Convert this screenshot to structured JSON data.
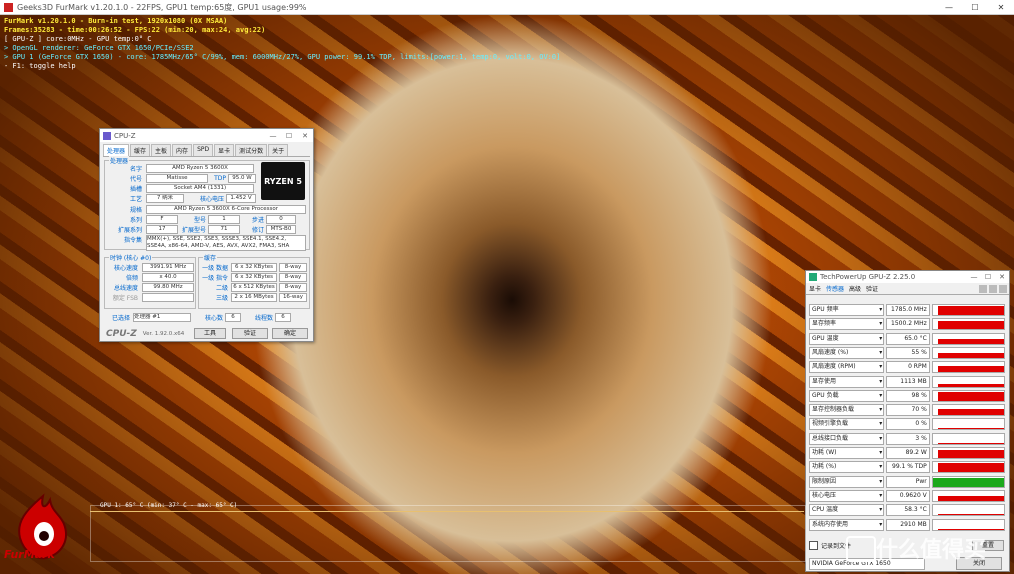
{
  "window": {
    "title": "Geeks3D FurMark v1.20.1.0 - 22FPS, GPU1 temp:65度, GPU1 usage:99%"
  },
  "overlay": {
    "lines": [
      "FurMark v1.20.1.0 - Burn-in test, 1920x1080 (0X MSAA)",
      "Frames:35283 - time:00:26:52 - FPS:22 (min:20, max:24, avg:22)",
      "[ GPU-Z ] core:0MHz - GPU temp:0° C",
      "> OpenGL renderer: GeForce GTX 1650/PCIe/SSE2",
      "> GPU 1 (GeForce GTX 1650) - core: 1785MHz/65° C/99%, mem: 6000MHz/27%, GPU power: 99.1% TDP, limits:[power:1, temp:0, volt:0, OV:0]",
      "- F1: toggle help"
    ]
  },
  "cpuz": {
    "title": "CPU-Z",
    "tabs": [
      "处理器",
      "缓存",
      "主板",
      "内存",
      "SPD",
      "显卡",
      "测试分数",
      "关于"
    ],
    "processor_group": "处理器",
    "name_label": "名字",
    "name": "AMD Ryzen 5 3600X",
    "code_label": "代号",
    "code": "Matisse",
    "tdp_label": "TDP",
    "tdp": "95.0 W",
    "package_label": "插槽",
    "package": "Socket AM4 (1331)",
    "tech_label": "工艺",
    "tech": "7 纳米",
    "voltage_label": "核心电压",
    "voltage": "1.452 V",
    "spec_label": "规格",
    "spec": "AMD Ryzen 5 3600X 6-Core Processor",
    "family_label": "系列",
    "family": "F",
    "model_label": "型号",
    "model": "1",
    "stepping_label": "步进",
    "stepping": "0",
    "ext_family_label": "扩展系列",
    "ext_family": "17",
    "ext_model_label": "扩展型号",
    "ext_model": "71",
    "revision_label": "修订",
    "revision": "MTS-B0",
    "instr_label": "指令集",
    "instr": "MMX(+), SSE, SSE2, SSE3, SSSE3, SSE4.1, SSE4.2, SSE4A, x86-64, AMD-V, AES, AVX, AVX2, FMA3, SHA",
    "clocks_group": "时钟 (核心 #0)",
    "core_speed_label": "核心速度",
    "core_speed": "3991.91 MHz",
    "multiplier_label": "倍频",
    "multiplier": "x 40.0",
    "bus_label": "总线速度",
    "bus": "99.80 MHz",
    "fsb_label": "额定 FSB",
    "fsb": "",
    "cache_group": "缓存",
    "l1d_label": "一级 数据",
    "l1d": "6 x 32 KBytes",
    "l1d_way": "8-way",
    "l1i_label": "一级 指令",
    "l1i": "6 x 32 KBytes",
    "l1i_way": "8-way",
    "l2_label": "二级",
    "l2": "6 x 512 KBytes",
    "l2_way": "8-way",
    "l3_label": "三级",
    "l3": "2 x 16 MBytes",
    "l3_way": "16-way",
    "selection_label": "已选择",
    "selection": "处理器 #1",
    "cores_label": "核心数",
    "cores": "6",
    "threads_label": "线程数",
    "threads": "6",
    "version": "Ver. 1.92.0.x64",
    "tools_label": "工具",
    "validate_label": "验证",
    "ok_label": "确定",
    "logo_text": "RYZEN 5"
  },
  "gpuz": {
    "title": "TechPowerUp GPU-Z 2.25.0",
    "tabs": [
      "显卡",
      "传感器",
      "高级",
      "验证"
    ],
    "sensors": [
      {
        "name": "GPU 频率",
        "value": "1785.0 MHz",
        "fill": 0.95
      },
      {
        "name": "显存频率",
        "value": "1500.2 MHz",
        "fill": 0.9
      },
      {
        "name": "GPU 温度",
        "value": "65.0 °C",
        "fill": 0.6
      },
      {
        "name": "风扇速度 (%)",
        "value": "55 %",
        "fill": 0.5
      },
      {
        "name": "风扇速度 (RPM)",
        "value": "0 RPM",
        "fill": 0.7
      },
      {
        "name": "显存使用",
        "value": "1113 MB",
        "fill": 0.3
      },
      {
        "name": "GPU 负载",
        "value": "98 %",
        "fill": 0.95
      },
      {
        "name": "显存控制器负载",
        "value": "70 %",
        "fill": 0.7
      },
      {
        "name": "视频引擎负载",
        "value": "0 %",
        "fill": 0.05
      },
      {
        "name": "总线接口负载",
        "value": "3 %",
        "fill": 0.05
      },
      {
        "name": "功耗 (W)",
        "value": "89.2 W",
        "fill": 0.85
      },
      {
        "name": "功耗 (%)",
        "value": "99.1 % TDP",
        "fill": 0.95
      },
      {
        "name": "限制原因",
        "value": "Pwr",
        "fill": 1.0
      },
      {
        "name": "核心电压",
        "value": "0.9620 V",
        "fill": 0.6
      },
      {
        "name": "CPU 温度",
        "value": "58.3 °C",
        "fill": 0.1
      },
      {
        "name": "系统内存使用",
        "value": "2910 MB",
        "fill": 0.1
      }
    ],
    "log_label": "记录到文件",
    "reset_label": "重置",
    "card_select": "NVIDIA GeForce GTX 1650",
    "close_label": "关闭",
    "bar_color": "#e00000",
    "limit_color": "#1aa81a"
  },
  "graph": {
    "label": "GPU 1: 65° C (min: 37° C - max: 65° C)",
    "line_color": "#e8c070"
  },
  "logo": {
    "text": "FurMark"
  },
  "watermark": {
    "text": "什么值得买"
  }
}
